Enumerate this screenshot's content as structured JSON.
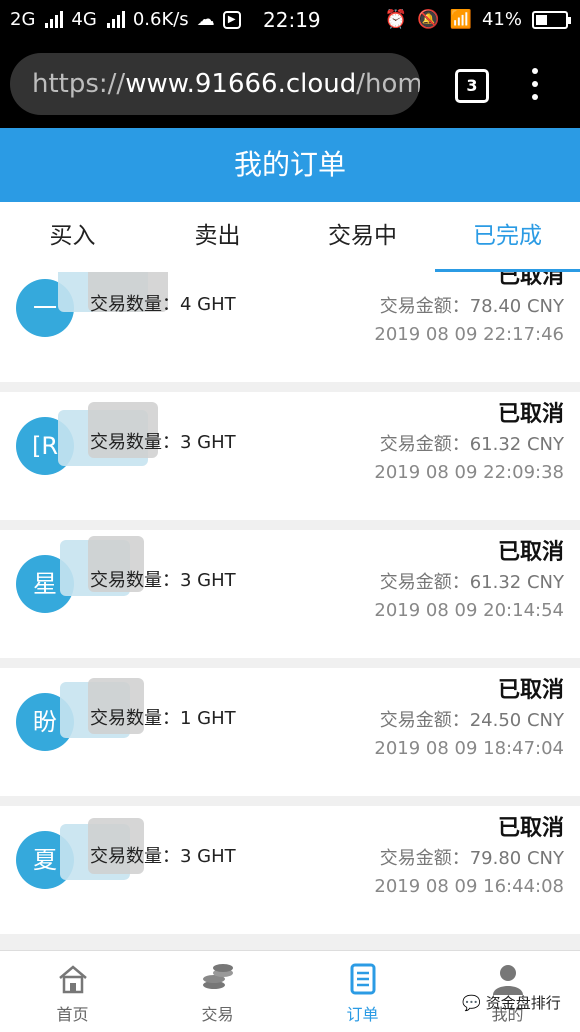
{
  "status_bar": {
    "network": "2G",
    "network2": "4G",
    "speed": "0.6K/s",
    "time": "22:19",
    "battery": "41%",
    "battery_level": 0.41
  },
  "browser": {
    "scheme": "https://",
    "host": "www.91666.cloud",
    "path": "/home",
    "tab_count": "3"
  },
  "header": {
    "title": "我的订单"
  },
  "tabs": [
    {
      "label": "买入"
    },
    {
      "label": "卖出"
    },
    {
      "label": "交易中"
    },
    {
      "label": "已完成"
    }
  ],
  "orders": [
    {
      "avatar": "一",
      "quantity": "交易数量：4 GHT",
      "status": "已取消",
      "amount": "交易金额：78.40 CNY",
      "time": "2019 08 09 22:17:46"
    },
    {
      "avatar": "[R",
      "quantity": "交易数量：3 GHT",
      "status": "已取消",
      "amount": "交易金额：61.32 CNY",
      "time": "2019 08 09 22:09:38"
    },
    {
      "avatar": "星",
      "quantity": "交易数量：3 GHT",
      "status": "已取消",
      "amount": "交易金额：61.32 CNY",
      "time": "2019 08 09 20:14:54"
    },
    {
      "avatar": "盼",
      "quantity": "交易数量：1 GHT",
      "status": "已取消",
      "amount": "交易金额：24.50 CNY",
      "time": "2019 08 09 18:47:04"
    },
    {
      "avatar": "夏",
      "quantity": "交易数量：3 GHT",
      "status": "已取消",
      "amount": "交易金额：79.80 CNY",
      "time": "2019 08 09 16:44:08"
    }
  ],
  "bottom_nav": [
    {
      "label": "首页",
      "icon": "home-icon"
    },
    {
      "label": "交易",
      "icon": "coins-icon"
    },
    {
      "label": "订单",
      "icon": "order-list-icon"
    },
    {
      "label": "我的",
      "icon": "user-icon"
    }
  ],
  "watermark": "资金盘排行",
  "colors": {
    "accent": "#2b9be4",
    "avatar": "#35a9dc"
  }
}
